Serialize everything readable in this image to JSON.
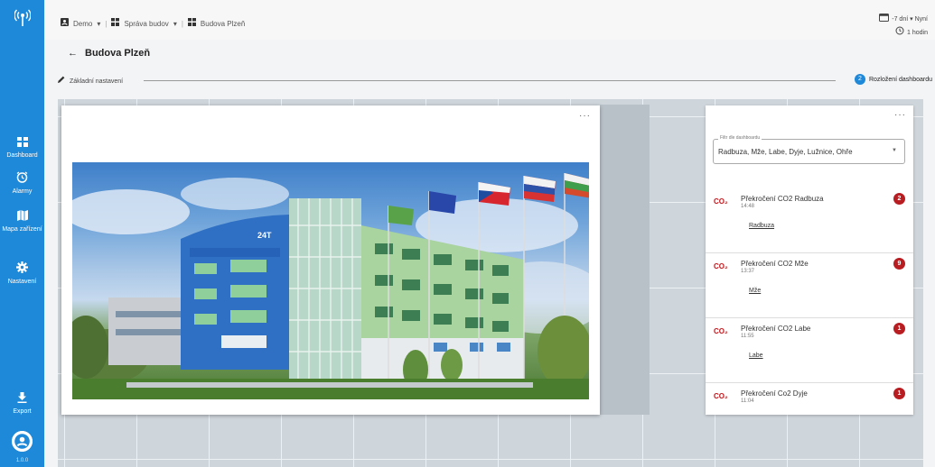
{
  "sidebar": {
    "logo_icon": "antenna-icon",
    "items": [
      {
        "label": "Dashboard",
        "icon": "dashboard-icon"
      },
      {
        "label": "Alarmy",
        "icon": "alarm-clock-icon"
      },
      {
        "label": "Mapa zařízení",
        "icon": "map-icon"
      },
      {
        "label": "Nastavení",
        "icon": "gear-icon"
      },
      {
        "label": "Export",
        "icon": "download-icon"
      }
    ],
    "user_icon": "account-circle-icon",
    "version": "1.0.0"
  },
  "topbar": {
    "breadcrumbs": [
      "Demo",
      "Správa budov",
      "Budova Plzeň"
    ],
    "time_range": "-7 dní",
    "time_anchor": "Nyní",
    "refresh": "1 hodin"
  },
  "page": {
    "title": "Budova Plzeň"
  },
  "stepper": {
    "step1_label": "Základní nastavení",
    "step2_number": "2",
    "step2_label": "Rozložení dashboardu"
  },
  "image_widget": {
    "menu": "···",
    "photo": "building-photo"
  },
  "alarm_widget": {
    "menu": "···",
    "filter_label": "Filtr dle dashboardu",
    "filter_value": "Radbuza, Mže, Labe, Dyje, Lužnice, Ohře",
    "icon_text": "CO₂",
    "alarms": [
      {
        "title": "Překročení CO2 Radbuza",
        "time": "14:48",
        "count": "2",
        "link": "Radbuza"
      },
      {
        "title": "Překročení CO2 Mže",
        "time": "13:37",
        "count": "9",
        "link": "Mže"
      },
      {
        "title": "Překročení CO2 Labe",
        "time": "11:55",
        "count": "1",
        "link": "Labe"
      },
      {
        "title": "Překročení Co2 Dyje",
        "time": "11:04",
        "count": "1",
        "link": ""
      }
    ]
  },
  "colors": {
    "sidebar": "#1e88d9",
    "alarm_red": "#b81d22",
    "grid": "#ced5db"
  }
}
